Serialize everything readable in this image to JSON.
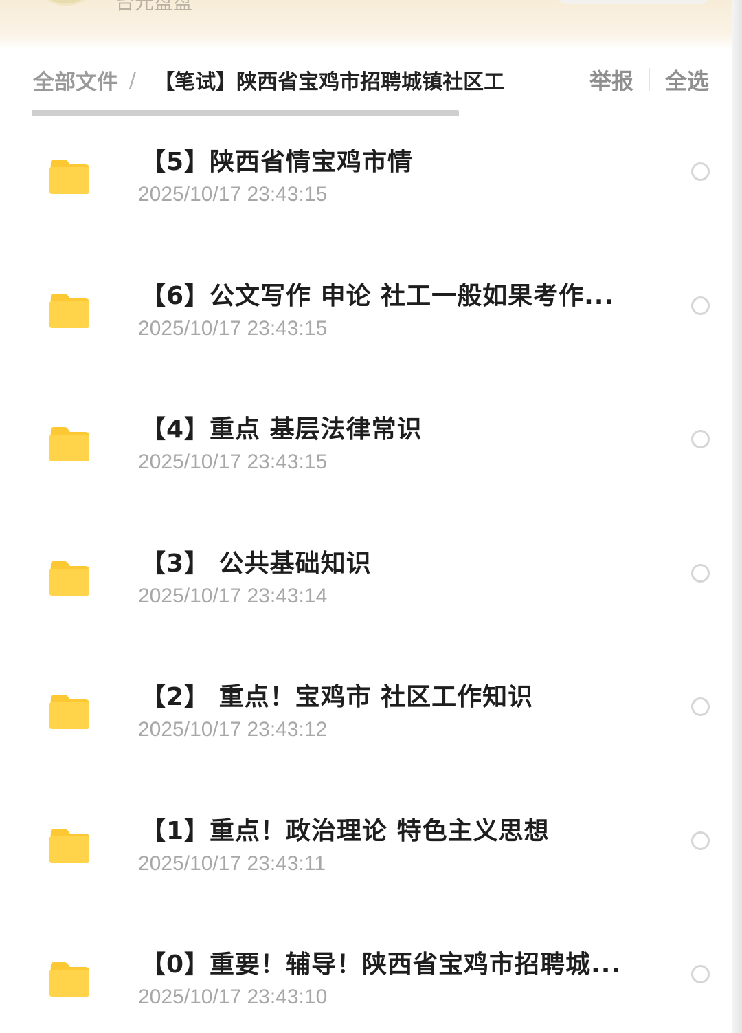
{
  "header": {
    "sub_text": "台元盘盘",
    "breadcrumb_root": "全部文件",
    "breadcrumb_separator": "/",
    "breadcrumb_current": "【笔试】陕西省宝鸡市招聘城镇社区工",
    "report_label": "举报",
    "select_all_label": "全选"
  },
  "files": [
    {
      "name": "【5】陕西省情宝鸡市情",
      "time": "2025/10/17 23:43:15",
      "icon": "folder-icon",
      "selected": false
    },
    {
      "name": "【6】公文写作 申论 社工一般如果考作...",
      "time": "2025/10/17 23:43:15",
      "icon": "folder-icon",
      "selected": false
    },
    {
      "name": "【4】重点 基层法律常识",
      "time": "2025/10/17 23:43:15",
      "icon": "folder-icon",
      "selected": false
    },
    {
      "name": "【3】 公共基础知识",
      "time": "2025/10/17 23:43:14",
      "icon": "folder-icon",
      "selected": false
    },
    {
      "name": "【2】 重点！宝鸡市 社区工作知识",
      "time": "2025/10/17 23:43:12",
      "icon": "folder-icon",
      "selected": false
    },
    {
      "name": "【1】重点！政治理论 特色主义思想",
      "time": "2025/10/17 23:43:11",
      "icon": "folder-icon",
      "selected": false
    },
    {
      "name": "【0】重要！辅导！陕西省宝鸡市招聘城...",
      "time": "2025/10/17 23:43:10",
      "icon": "folder-icon",
      "selected": false
    }
  ],
  "colors": {
    "folder": "#ffd44a",
    "folder_tab": "#fcc934",
    "text_primary": "#1e1e1e",
    "text_secondary": "#a7a7a7"
  }
}
